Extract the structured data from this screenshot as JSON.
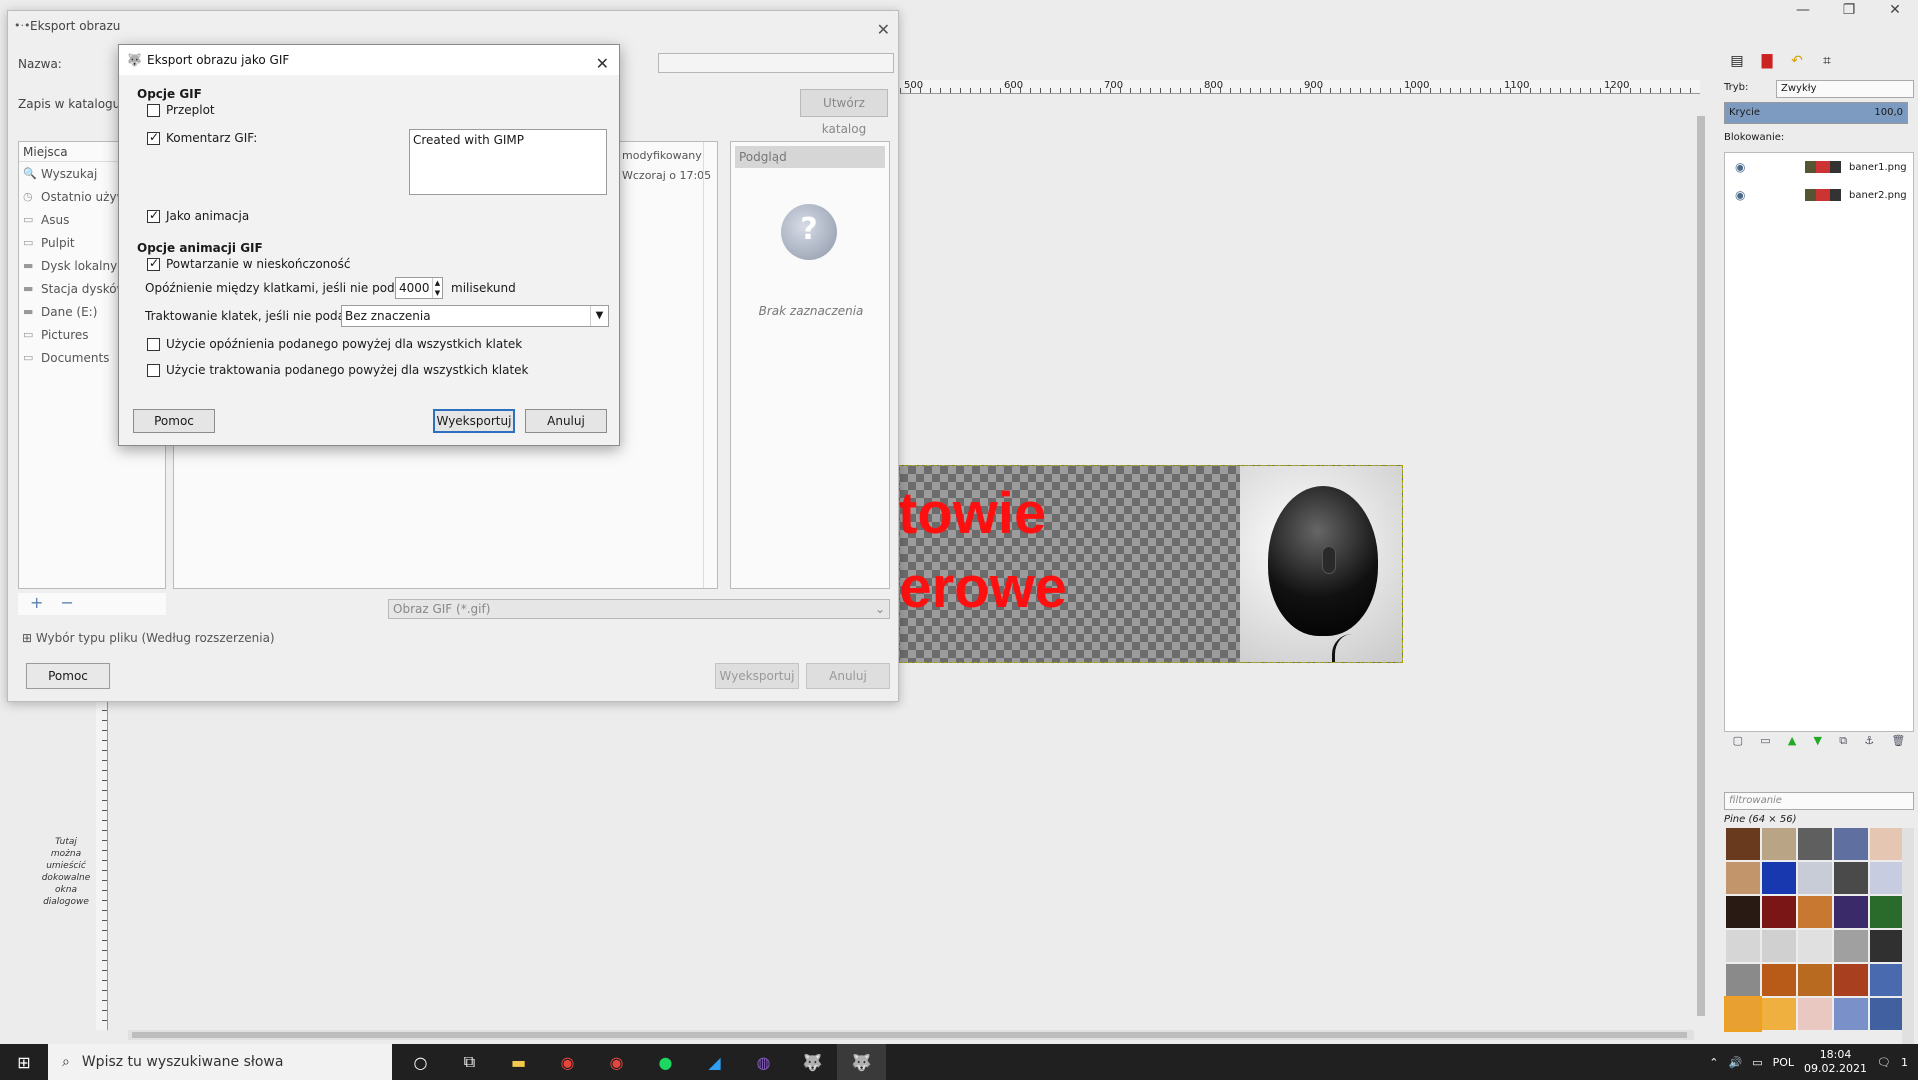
{
  "gimp": {
    "title": "",
    "canvas_text_line1": "towie",
    "canvas_text_line2": "terowe",
    "left_hint": "Tutaj można umieścić dokowalne okna dialogowe",
    "ruler_ticks": [
      "500",
      "600",
      "700",
      "800",
      "900",
      "1000",
      "1100",
      "1200"
    ]
  },
  "right_dock": {
    "mode_label": "Tryb:",
    "mode_value": "Zwykły",
    "opacity_label": "Krycie",
    "opacity_value": "100,0",
    "lock_label": "Blokowanie:",
    "layers": [
      {
        "name": "baner1.png"
      },
      {
        "name": "baner2.png"
      }
    ],
    "filter_placeholder": "filtrowanie",
    "pattern_name": "Pine (64 × 56)",
    "pattern_colors": [
      "#6a3a1e",
      "#b9a585",
      "#5f5f5f",
      "#5f6f9f",
      "#e4c6b2",
      "#c2966a",
      "#1838b0",
      "#c8ccd6",
      "#4a4a4a",
      "#c8cce0",
      "#2a1a14",
      "#7a1616",
      "#c87830",
      "#3a2a6a",
      "#2a6a2a",
      "#d6d6d6",
      "#d0d0d0",
      "#e0e0e0",
      "#a0a0a0",
      "#303030",
      "#8a8a8a",
      "#b85a18",
      "#b86a20",
      "#a84020",
      "#4a6ab0",
      "#e8a030",
      "#f0b040",
      "#e8c8c0",
      "#7a90c8",
      "#4060a0"
    ]
  },
  "export_dialog": {
    "title": "Eksport obrazu",
    "name_label": "Nazwa:",
    "folder_label": "Zapis w katalogu:",
    "create_folder": "Utwórz katalog",
    "places_header": "Miejsca",
    "places": [
      {
        "icon": "search-icon",
        "glyph": "🔍",
        "label": "Wyszukaj"
      },
      {
        "icon": "recent-icon",
        "glyph": "◷",
        "label": "Ostatnio używa"
      },
      {
        "icon": "folder-icon",
        "glyph": "▭",
        "label": "Asus"
      },
      {
        "icon": "folder-icon",
        "glyph": "▭",
        "label": "Pulpit"
      },
      {
        "icon": "drive-icon",
        "glyph": "▬",
        "label": "Dysk lokalny (C"
      },
      {
        "icon": "drive-icon",
        "glyph": "▬",
        "label": "Stacja dysków D"
      },
      {
        "icon": "drive-icon",
        "glyph": "▬",
        "label": "Dane (E:)"
      },
      {
        "icon": "folder-icon",
        "glyph": "▭",
        "label": "Pictures"
      },
      {
        "icon": "folder-icon",
        "glyph": "▭",
        "label": "Documents"
      }
    ],
    "modified_header": "modyfikowany",
    "modified_value": "Wczoraj o 17:05",
    "preview_header": "Podgląd",
    "preview_caption": "Brak zaznaczenia",
    "filetype_value": "Obraz GIF (*.gif)",
    "filetype_expander": "Wybór typu pliku (Według rozszerzenia)",
    "help": "Pomoc",
    "export": "Wyeksportuj",
    "cancel": "Anuluj"
  },
  "gif_dialog": {
    "title": "Eksport obrazu jako GIF",
    "section_gif": "Opcje GIF",
    "interlace": "Przeplot",
    "gif_comment": "Komentarz GIF:",
    "comment_text": "Created with GIMP",
    "as_animation": "Jako animacja",
    "section_anim": "Opcje animacji GIF",
    "loop_forever": "Powtarzanie w nieskończoność",
    "delay_label": "Opóźnienie między klatkami, jeśli nie podano:",
    "delay_value": "4000",
    "delay_unit": "milisekund",
    "disposal_label": "Traktowanie klatek, jeśli nie podano:",
    "disposal_value": "Bez znaczenia",
    "use_delay_all": "Użycie opóźnienia podanego powyżej dla wszystkich klatek",
    "use_disposal_all": "Użycie traktowania podanego powyżej dla wszystkich klatek",
    "help": "Pomoc",
    "export": "Wyeksportuj",
    "cancel": "Anuluj"
  },
  "taskbar": {
    "search_placeholder": "Wpisz tu wyszukiwane słowa",
    "lang": "POL",
    "time": "18:04",
    "date": "09.02.2021",
    "notifications": "1"
  }
}
